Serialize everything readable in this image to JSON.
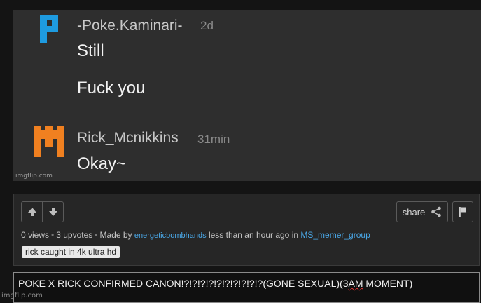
{
  "meme": {
    "comments": [
      {
        "username": "-Poke.Kaminari-",
        "time": "2d",
        "messages": [
          "Still",
          "Fuck you"
        ],
        "avatar_icon": "letter-p-avatar-icon",
        "avatar_color": "#1e9be0"
      },
      {
        "username": "Rick_Mcnikkins",
        "time": "31min",
        "messages": [
          "Okay~"
        ],
        "avatar_icon": "castle-avatar-icon",
        "avatar_color": "#f08020"
      }
    ],
    "watermark": "imgflip.com"
  },
  "info": {
    "share_label": "share",
    "views": "0 views",
    "upvotes": "3 upvotes",
    "made_by_prefix": "Made by",
    "author": "energeticbombhands",
    "time_text": "less than an hour ago in",
    "stream": "MS_memer_group",
    "tag": "rick caught in 4k ultra hd"
  },
  "caption": {
    "text_before": "POKE X RICK CONFIRMED CANON!?!?!?!?!?!?!?!?!?!?(GONE SEXUAL)(3",
    "text_squiggle": "AM",
    "text_after": " MOMENT)"
  },
  "site_watermark": "imgflip.com",
  "colors": {
    "link": "#4aa8e8",
    "poke_avatar": "#1e9be0",
    "rick_avatar": "#f08020"
  }
}
